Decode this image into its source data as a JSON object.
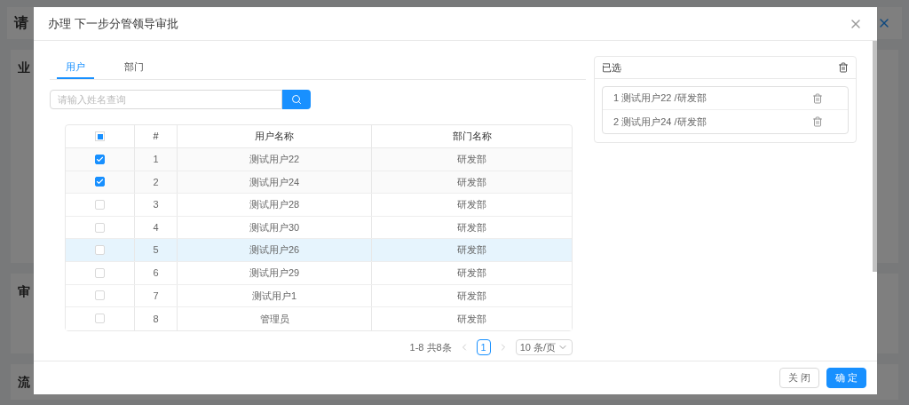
{
  "background_page": {
    "title": "请",
    "sections": [
      "业",
      "审",
      "流"
    ]
  },
  "dialog": {
    "title": "办理 下一步分管领导审批",
    "tabs": [
      {
        "label": "用户",
        "selected": true
      },
      {
        "label": "部门",
        "selected": false
      }
    ],
    "search": {
      "placeholder": "请输入姓名查询"
    },
    "table": {
      "select_all": {
        "indeterminate": true
      },
      "columns": [
        "#",
        "用户名称",
        "部门名称"
      ],
      "rows": [
        {
          "index": "1",
          "name": "测试用户22",
          "dept": "研发部",
          "checked": true,
          "hovered": false
        },
        {
          "index": "2",
          "name": "测试用户24",
          "dept": "研发部",
          "checked": true,
          "hovered": false
        },
        {
          "index": "3",
          "name": "测试用户28",
          "dept": "研发部",
          "checked": false,
          "hovered": false
        },
        {
          "index": "4",
          "name": "测试用户30",
          "dept": "研发部",
          "checked": false,
          "hovered": false
        },
        {
          "index": "5",
          "name": "测试用户26",
          "dept": "研发部",
          "checked": false,
          "hovered": true
        },
        {
          "index": "6",
          "name": "测试用户29",
          "dept": "研发部",
          "checked": false,
          "hovered": false
        },
        {
          "index": "7",
          "name": "测试用户1",
          "dept": "研发部",
          "checked": false,
          "hovered": false
        },
        {
          "index": "8",
          "name": "管理员",
          "dept": "研发部",
          "checked": false,
          "hovered": false
        }
      ]
    },
    "pagination": {
      "total": "1-8 共8条",
      "pages": [
        {
          "label": "1",
          "selected": true
        }
      ],
      "page_size": "10 条/页"
    },
    "selected_panel": {
      "title": "已选",
      "items": [
        {
          "index": "1",
          "label": "测试用户22 /研发部"
        },
        {
          "index": "2",
          "label": "测试用户24 /研发部"
        }
      ]
    },
    "buttons": [
      {
        "label": "关 闭",
        "kind": "default"
      },
      {
        "label": "确 定",
        "kind": "primary"
      }
    ]
  }
}
